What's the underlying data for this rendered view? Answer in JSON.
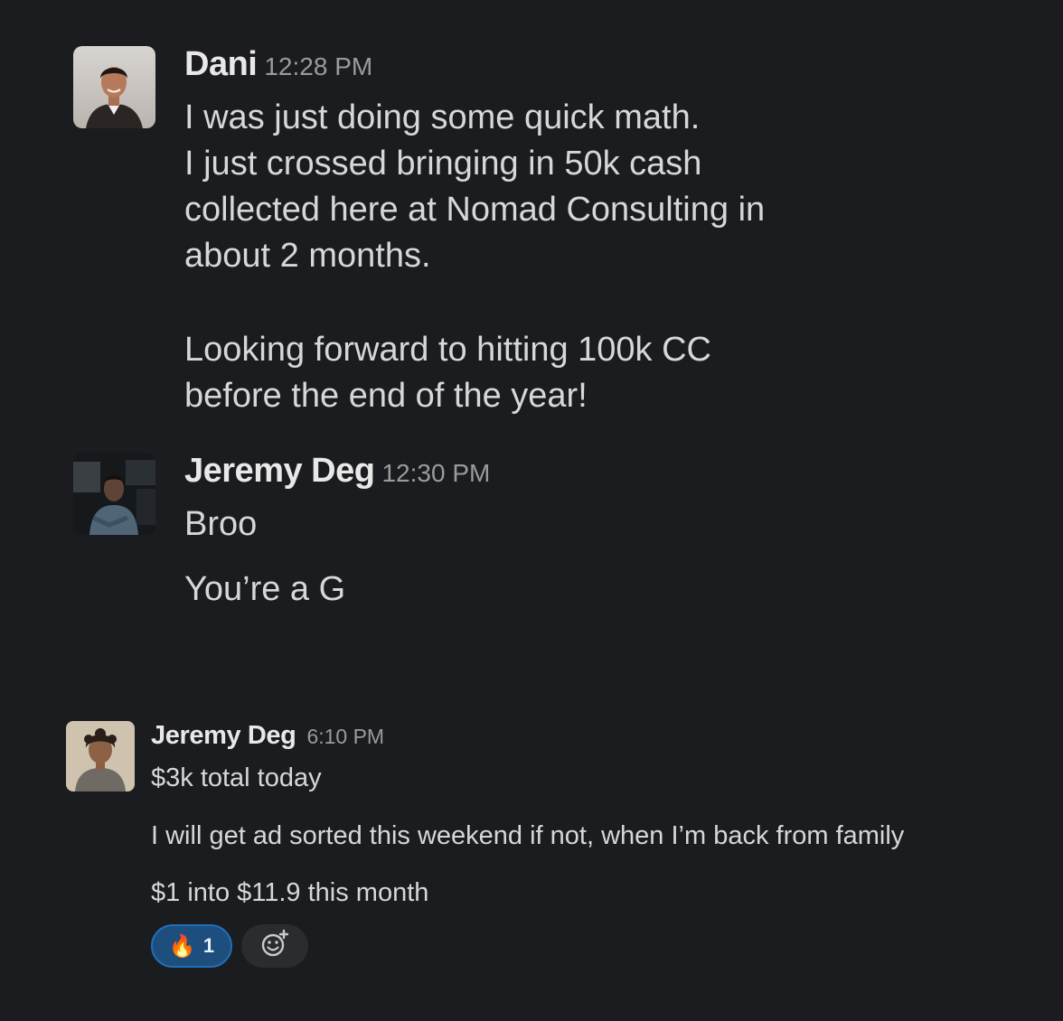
{
  "messages": [
    {
      "author": "Dani",
      "time": "12:28 PM",
      "lines": [
        "I was just doing some quick math.",
        "I just crossed bringing in 50k cash",
        "collected here at Nomad Consulting in",
        "about 2 months.",
        "Looking forward to hitting 100k CC",
        "before the end of the year!"
      ]
    },
    {
      "author": "Jeremy Deg",
      "time": "12:30 PM",
      "lines": [
        "Broo",
        "You’re a G"
      ]
    },
    {
      "author": "Jeremy Deg",
      "time": "6:10 PM",
      "lines": [
        "$3k total today",
        "I will get ad sorted this weekend if not, when I’m back from family",
        "$1 into $11.9 this month"
      ],
      "reactions": [
        {
          "emoji": "🔥",
          "icon": "fire-icon",
          "count": "1"
        }
      ],
      "add_reaction_icon": "add-reaction-icon"
    }
  ]
}
